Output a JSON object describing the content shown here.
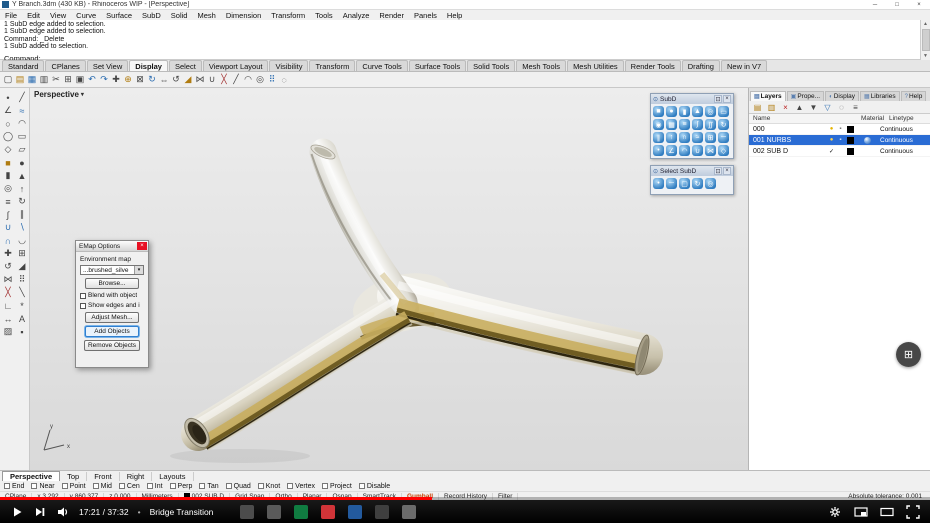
{
  "icons": {
    "chevron_down": "▾",
    "close": "×",
    "scroll_up": "▲",
    "scroll_down": "▼",
    "panel_menu": "⊙",
    "overlay_button": "⊞",
    "bullet": "•"
  },
  "window": {
    "title": "Y Branch.3dm (430 KB) - Rhinoceros WIP - [Perspective]",
    "controls": [
      {
        "name": "minimize-button",
        "glyph": "─"
      },
      {
        "name": "maximize-button",
        "glyph": "□"
      },
      {
        "name": "close-button",
        "glyph": "×"
      }
    ]
  },
  "menu": [
    "File",
    "Edit",
    "View",
    "Curve",
    "Surface",
    "SubD",
    "Solid",
    "Mesh",
    "Dimension",
    "Transform",
    "Tools",
    "Analyze",
    "Render",
    "Panels",
    "Help"
  ],
  "command": {
    "history": [
      "1 SubD edge added to selection.",
      "1 SubD edge added to selection.",
      "Command: _Delete",
      "1 SubD added to selection."
    ],
    "prompt": "Command:"
  },
  "toolbar_tabs": [
    {
      "label": "Standard",
      "cls": ""
    },
    {
      "label": "CPlanes",
      "cls": ""
    },
    {
      "label": "Set View",
      "cls": ""
    },
    {
      "label": "Display",
      "cls": "active"
    },
    {
      "label": "Select",
      "cls": ""
    },
    {
      "label": "Viewport Layout",
      "cls": ""
    },
    {
      "label": "Visibility",
      "cls": ""
    },
    {
      "label": "Transform",
      "cls": ""
    },
    {
      "label": "Curve Tools",
      "cls": ""
    },
    {
      "label": "Surface Tools",
      "cls": ""
    },
    {
      "label": "Solid Tools",
      "cls": ""
    },
    {
      "label": "Mesh Tools",
      "cls": ""
    },
    {
      "label": "Mesh Utilities",
      "cls": ""
    },
    {
      "label": "Render Tools",
      "cls": ""
    },
    {
      "label": "Drafting",
      "cls": ""
    },
    {
      "label": "New in V7",
      "cls": ""
    }
  ],
  "main_toolbar": [
    {
      "name": "new-file-icon",
      "glyph": "▢",
      "c": "#444"
    },
    {
      "name": "open-file-icon",
      "glyph": "▤",
      "c": "#b07c10"
    },
    {
      "name": "save-file-icon",
      "glyph": "▦",
      "c": "#2b6cb0"
    },
    {
      "name": "print-icon",
      "glyph": "▥",
      "c": "#444"
    },
    {
      "name": "cut-icon",
      "glyph": "✂",
      "c": "#444"
    },
    {
      "name": "copy-icon",
      "glyph": "⊞",
      "c": "#444"
    },
    {
      "name": "paste-icon",
      "glyph": "▣",
      "c": "#444"
    },
    {
      "name": "undo-icon",
      "glyph": "↶",
      "c": "#2b6cb0"
    },
    {
      "name": "redo-icon",
      "glyph": "↷",
      "c": "#2b6cb0"
    },
    {
      "name": "pan-icon",
      "glyph": "✚",
      "c": "#444"
    },
    {
      "name": "zoom-icon",
      "glyph": "⊕",
      "c": "#b07c10"
    },
    {
      "name": "zoom-extents-icon",
      "glyph": "⊠",
      "c": "#444"
    },
    {
      "name": "rotate-view-icon",
      "glyph": "↻",
      "c": "#2b6cb0"
    },
    {
      "name": "move-icon",
      "glyph": "⇔",
      "c": "#444"
    },
    {
      "name": "rotate-icon",
      "glyph": "↺",
      "c": "#444"
    },
    {
      "name": "scale-icon",
      "glyph": "◢",
      "c": "#b07c10"
    },
    {
      "name": "mirror-icon",
      "glyph": "⋈",
      "c": "#444"
    },
    {
      "name": "join-icon",
      "glyph": "∪",
      "c": "#444"
    },
    {
      "name": "trim-icon",
      "glyph": "╳",
      "c": "#a33333"
    },
    {
      "name": "split-icon",
      "glyph": "╱",
      "c": "#444"
    },
    {
      "name": "fillet-icon",
      "glyph": "◠",
      "c": "#444"
    },
    {
      "name": "offset-icon",
      "glyph": "◎",
      "c": "#444"
    },
    {
      "name": "array-icon",
      "glyph": "⠿",
      "c": "#2b6cb0"
    },
    {
      "name": "hide-icon",
      "glyph": "◌",
      "c": "#444"
    }
  ],
  "left_toolbar": [
    {
      "name": "point-tool-icon",
      "glyph": "•",
      "c": "#444"
    },
    {
      "name": "line-tool-icon",
      "glyph": "╱",
      "c": "#444"
    },
    {
      "name": "polyline-tool-icon",
      "glyph": "∠",
      "c": "#444"
    },
    {
      "name": "curve-tool-icon",
      "glyph": "≈",
      "c": "#2b6cb0"
    },
    {
      "name": "circle-tool-icon",
      "glyph": "○",
      "c": "#444"
    },
    {
      "name": "arc-tool-icon",
      "glyph": "◠",
      "c": "#444"
    },
    {
      "name": "ellipse-tool-icon",
      "glyph": "◯",
      "c": "#444"
    },
    {
      "name": "rectangle-tool-icon",
      "glyph": "▭",
      "c": "#444"
    },
    {
      "name": "polygon-tool-icon",
      "glyph": "◇",
      "c": "#444"
    },
    {
      "name": "plane-tool-icon",
      "glyph": "▱",
      "c": "#444"
    },
    {
      "name": "box-tool-icon",
      "glyph": "■",
      "c": "#b07c10"
    },
    {
      "name": "sphere-tool-icon",
      "glyph": "●",
      "c": "#444"
    },
    {
      "name": "cylinder-tool-icon",
      "glyph": "▮",
      "c": "#444"
    },
    {
      "name": "cone-tool-icon",
      "glyph": "▲",
      "c": "#444"
    },
    {
      "name": "torus-tool-icon",
      "glyph": "◎",
      "c": "#444"
    },
    {
      "name": "extrude-tool-icon",
      "glyph": "↑",
      "c": "#444"
    },
    {
      "name": "loft-tool-icon",
      "glyph": "≡",
      "c": "#444"
    },
    {
      "name": "revolve-tool-icon",
      "glyph": "↻",
      "c": "#444"
    },
    {
      "name": "sweep-tool-icon",
      "glyph": "∫",
      "c": "#444"
    },
    {
      "name": "pipe-tool-icon",
      "glyph": "∥",
      "c": "#444"
    },
    {
      "name": "boolean-union-icon",
      "glyph": "∪",
      "c": "#2b6cb0"
    },
    {
      "name": "boolean-difference-icon",
      "glyph": "∖",
      "c": "#2b6cb0"
    },
    {
      "name": "boolean-intersection-icon",
      "glyph": "∩",
      "c": "#2b6cb0"
    },
    {
      "name": "fillet-surface-icon",
      "glyph": "◡",
      "c": "#444"
    },
    {
      "name": "move-tool-icon",
      "glyph": "✚",
      "c": "#444"
    },
    {
      "name": "copy-tool-icon",
      "glyph": "⊞",
      "c": "#444"
    },
    {
      "name": "rotate-tool-icon",
      "glyph": "↺",
      "c": "#444"
    },
    {
      "name": "scale-tool-ic on",
      "glyph": "◢",
      "c": "#444"
    },
    {
      "name": "mirror-tool-icon",
      "glyph": "⋈",
      "c": "#444"
    },
    {
      "name": "array-tool-icon",
      "glyph": "⠿",
      "c": "#444"
    },
    {
      "name": "trim-tool-icon",
      "glyph": "╳",
      "c": "#a33333"
    },
    {
      "name": "split-tool-icon",
      "glyph": "╲",
      "c": "#444"
    },
    {
      "name": "join-tool-icon",
      "glyph": "∟",
      "c": "#444"
    },
    {
      "name": "explode-tool-icon",
      "glyph": "*",
      "c": "#444"
    },
    {
      "name": "dimension-tool-icon",
      "glyph": "↔",
      "c": "#444"
    },
    {
      "name": "text-tool-icon",
      "glyph": "A",
      "c": "#444"
    },
    {
      "name": "hatch-tool-icon",
      "glyph": "▨",
      "c": "#444"
    },
    {
      "name": "lock-tool-icon",
      "glyph": "▪",
      "c": "#444"
    }
  ],
  "viewport": {
    "label": "Perspective",
    "axis_x": "x",
    "axis_y": "y",
    "tabs": [
      {
        "label": "Perspective",
        "cls": "active"
      },
      {
        "label": "Top",
        "cls": ""
      },
      {
        "label": "Front",
        "cls": ""
      },
      {
        "label": "Right",
        "cls": ""
      },
      {
        "label": "Layouts",
        "cls": ""
      }
    ]
  },
  "subd_panel": {
    "title": "SubD",
    "buttons": [
      {
        "name": "panel-dock-icon",
        "glyph": "⊡"
      },
      {
        "name": "panel-close-icon",
        "glyph": "×"
      }
    ],
    "icons": [
      {
        "name": "subd-box-icon",
        "glyph": "■"
      },
      {
        "name": "subd-sphere-icon",
        "glyph": "●"
      },
      {
        "name": "subd-cylinder-icon",
        "glyph": "▮"
      },
      {
        "name": "subd-cone-icon",
        "glyph": "▲"
      },
      {
        "name": "subd-torus-icon",
        "glyph": "◎"
      },
      {
        "name": "subd-plane-icon",
        "glyph": "▭"
      },
      {
        "name": "subd-ellipsoid-icon",
        "glyph": "◉"
      },
      {
        "name": "subd-from-mesh-icon",
        "glyph": "▦"
      },
      {
        "name": "subd-loft-icon",
        "glyph": "≡"
      },
      {
        "name": "subd-sweep1-icon",
        "glyph": "∫"
      },
      {
        "name": "subd-sweep2-icon",
        "glyph": "∬"
      },
      {
        "name": "subd-revolve-icon",
        "glyph": "↻"
      },
      {
        "name": "subd-multipipe-icon",
        "glyph": "∥"
      },
      {
        "name": "subd-extrude-icon",
        "glyph": "↑"
      },
      {
        "name": "subd-bridge-icon",
        "glyph": "∩"
      },
      {
        "name": "subd-stitch-icon",
        "glyph": "≈"
      },
      {
        "name": "subd-append-icon",
        "glyph": "⊞"
      },
      {
        "name": "subd-insert-edge-icon",
        "glyph": "─"
      },
      {
        "name": "subd-insert-point-icon",
        "glyph": "•"
      },
      {
        "name": "subd-crease-icon",
        "glyph": "∠"
      },
      {
        "name": "subd-remove-crease-icon",
        "glyph": "◠"
      },
      {
        "name": "subd-merge-faces-icon",
        "glyph": "∪"
      },
      {
        "name": "subd-reflect-icon",
        "glyph": "⋈"
      },
      {
        "name": "subd-symmetry-icon",
        "glyph": "◇"
      }
    ]
  },
  "select_subd_panel": {
    "title": "Select SubD",
    "buttons": [
      {
        "name": "panel-dock-icon",
        "glyph": "⊡"
      },
      {
        "name": "panel-close-icon",
        "glyph": "×"
      }
    ],
    "icons": [
      {
        "name": "select-subd-vertices-icon",
        "glyph": "•"
      },
      {
        "name": "select-subd-edges-icon",
        "glyph": "─"
      },
      {
        "name": "select-subd-faces-icon",
        "glyph": "▢"
      },
      {
        "name": "select-subd-loop-icon",
        "glyph": "↻"
      },
      {
        "name": "select-subd-ring-icon",
        "glyph": "◎"
      }
    ]
  },
  "emap_dialog": {
    "title": "EMap Options",
    "env_label": "Environment map",
    "dropdown_value": "...brushed_silve",
    "browse_label": "Browse...",
    "checkboxes": [
      {
        "label": "Blend with object"
      },
      {
        "label": "Show edges and i"
      }
    ],
    "buttons": [
      {
        "label": "Adjust Mesh...",
        "cls": ""
      },
      {
        "label": "Add Objects",
        "cls": "highlight"
      },
      {
        "label": "Remove Objects",
        "cls": ""
      }
    ]
  },
  "right_panel": {
    "tabs": [
      {
        "label": "Layers",
        "glyph": "▤",
        "cls": "active"
      },
      {
        "label": "Prope...",
        "glyph": "▣",
        "cls": ""
      },
      {
        "label": "Display",
        "glyph": "◐",
        "cls": ""
      },
      {
        "label": "Libraries",
        "glyph": "▦",
        "cls": ""
      },
      {
        "label": "Help",
        "glyph": "?",
        "cls": ""
      }
    ],
    "toolbar": [
      {
        "name": "new-layer-icon",
        "glyph": "▤",
        "c": "#b07c10"
      },
      {
        "name": "new-sublayer-icon",
        "glyph": "▥",
        "c": "#b07c10"
      },
      {
        "name": "delete-layer-icon",
        "glyph": "×",
        "c": "#bb2222"
      },
      {
        "name": "move-up-icon",
        "glyph": "▲",
        "c": "#444"
      },
      {
        "name": "move-down-icon",
        "glyph": "▼",
        "c": "#444"
      },
      {
        "name": "filter-icon",
        "glyph": "▽",
        "c": "#2b6cb0"
      },
      {
        "name": "search-icon",
        "glyph": "◌",
        "c": "#444"
      },
      {
        "name": "layer-tools-icon",
        "glyph": "≡",
        "c": "#444"
      }
    ],
    "columns": [
      "Name",
      "Material",
      "Linetype"
    ],
    "layers": [
      {
        "name": "000",
        "cls": "",
        "i1": "●",
        "i1c": "#e6b400",
        "i2": "▪",
        "i2c": "#777",
        "swatch": "#000000",
        "ballcls": "noshow",
        "linetype": "Continuous"
      },
      {
        "name": "001 NURBS",
        "cls": "selected",
        "i1": "●",
        "i1c": "#ffd24d",
        "i2": "▪",
        "i2c": "#cfe0f5",
        "swatch": "#000000",
        "ballcls": "ball",
        "linetype": "Continuous"
      },
      {
        "name": "002 SUB D",
        "cls": "",
        "i1": "✓",
        "i1c": "#111111",
        "i2": "",
        "i2c": "#777",
        "swatch": "#000000",
        "ballcls": "noshow",
        "linetype": "Continuous"
      }
    ]
  },
  "osnap": [
    {
      "label": "End"
    },
    {
      "label": "Near"
    },
    {
      "label": "Point"
    },
    {
      "label": "Mid"
    },
    {
      "label": "Cen"
    },
    {
      "label": "Int"
    },
    {
      "label": "Perp"
    },
    {
      "label": "Tan"
    },
    {
      "label": "Quad"
    },
    {
      "label": "Knot"
    },
    {
      "label": "Vertex"
    },
    {
      "label": "Project"
    },
    {
      "label": "Disable"
    }
  ],
  "status_bar": {
    "fields": [
      "CPlane",
      "x 3.292",
      "y 860.377",
      "z 0.000",
      "Millimeters"
    ],
    "layer_swatch": "#000000",
    "layer": "002 SUB D",
    "toggles": [
      {
        "label": "Grid Snap",
        "cls": ""
      },
      {
        "label": "Ortho",
        "cls": ""
      },
      {
        "label": "Planar",
        "cls": ""
      },
      {
        "label": "Osnap",
        "cls": ""
      },
      {
        "label": "SmartTrack",
        "cls": ""
      },
      {
        "label": "Gumball",
        "cls": "active"
      },
      {
        "label": "Record History",
        "cls": ""
      },
      {
        "label": "Filter",
        "cls": ""
      }
    ],
    "tolerance": "Absolute tolerance: 0.001"
  },
  "video": {
    "time": "17:21 / 37:32",
    "separator": "•",
    "chapter": "Bridge Transition",
    "progress_w": "46.5%",
    "apps": [
      {
        "name": "taskbar-app-icon",
        "bg": "#4c4c4c"
      },
      {
        "name": "taskbar-app-icon",
        "bg": "#5a5a5a"
      },
      {
        "name": "taskbar-app-icon",
        "bg": "#107c41"
      },
      {
        "name": "taskbar-app-icon",
        "bg": "#d13438"
      },
      {
        "name": "taskbar-app-icon",
        "bg": "#235a9e"
      },
      {
        "name": "taskbar-app-icon",
        "bg": "#3f3f3f"
      },
      {
        "name": "taskbar-app-icon",
        "bg": "#6b6b6b"
      }
    ]
  }
}
